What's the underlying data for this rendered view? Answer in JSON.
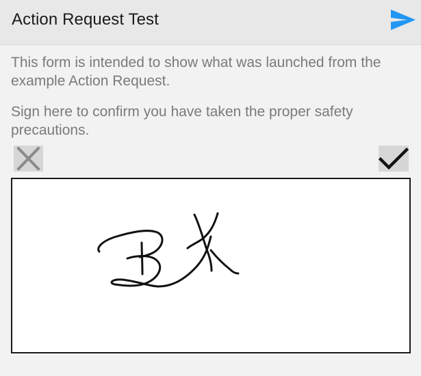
{
  "header": {
    "title": "Action Request Test",
    "send_icon": "send-icon",
    "accent_color": "#2196f3"
  },
  "content": {
    "intro_text": "This form is intended to show what was launched from the example Action Request.",
    "signature_prompt": "Sign here to confirm you have taken the proper safety precautions."
  },
  "signature": {
    "clear_icon": "close-icon",
    "confirm_icon": "check-icon",
    "signed_initials": "BK"
  }
}
